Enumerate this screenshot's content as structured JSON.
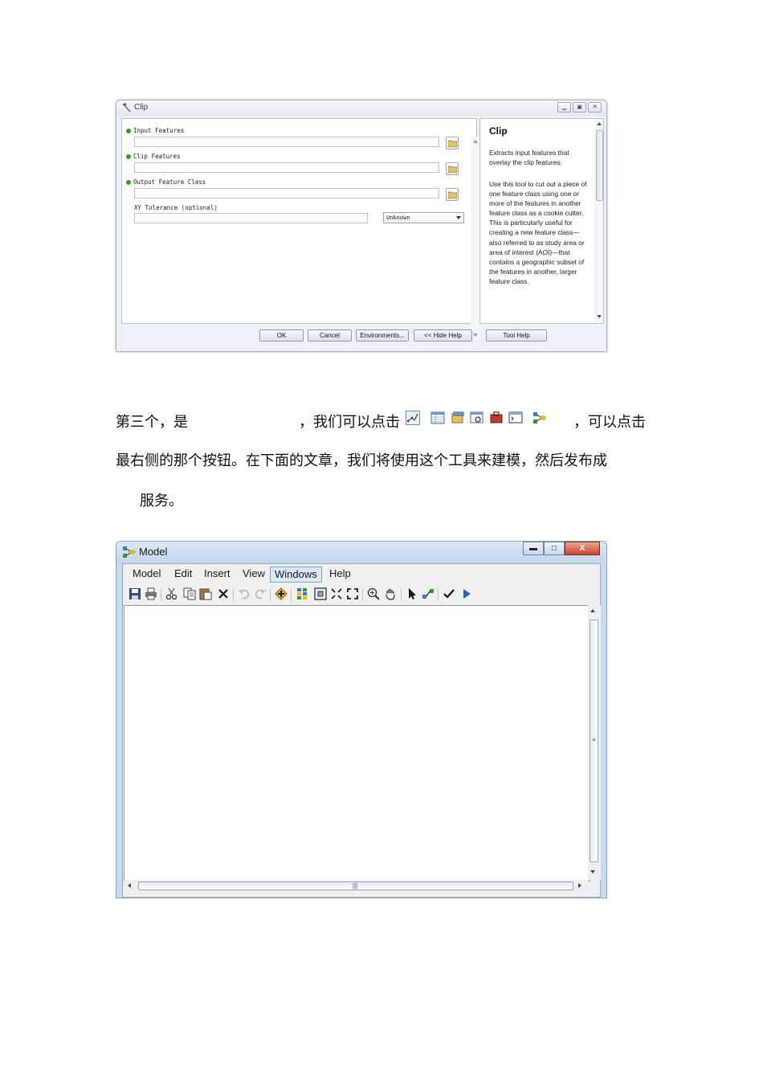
{
  "clip_dialog": {
    "title": "Clip",
    "window_controls": [
      "minimize",
      "restore",
      "close"
    ],
    "params": [
      {
        "label": "Input Features",
        "required": true,
        "value": ""
      },
      {
        "label": "Clip Features",
        "required": true,
        "value": ""
      },
      {
        "label": "Output Feature Class",
        "required": true,
        "value": ""
      },
      {
        "label": "XY Tolerance (optional)",
        "required": false,
        "value": ""
      }
    ],
    "unit_select": "Unknown",
    "help": {
      "title": "Clip",
      "p1": "Extracts input features that overlay the clip features.",
      "p2": "Use this tool to cut out a piece of one feature class using one or more of the features in another feature class as a cookie cutter. This is particularly useful for creating a new feature class—also referred to as study area or area of interest (AOI)—that contains a geographic subset of the features in another, larger feature class."
    },
    "buttons": {
      "ok": "OK",
      "cancel": "Cancel",
      "environments": "Environments...",
      "hide_help": "<< Hide Help",
      "tool_help": "Tool Help"
    }
  },
  "paragraph": {
    "line1_a": "第三个，是",
    "line1_b": "，我们可以点击",
    "line1_c": "，可以点击",
    "line2": "最右侧的那个按钮。在下面的文章，我们将使用这个工具来建模，然后发布成",
    "line3": "服务。",
    "inline_icons": [
      "editor-toolbar-icon",
      "table-icon",
      "catalog-icon",
      "search-window-icon",
      "arctoolbox-icon",
      "python-window-icon",
      "modelbuilder-icon"
    ]
  },
  "model_window": {
    "title": "Model",
    "window_controls": {
      "minimize": "▬",
      "maximize": "□",
      "close": "X"
    },
    "menu": [
      "Model",
      "Edit",
      "Insert",
      "View",
      "Windows",
      "Help"
    ],
    "active_menu": "Windows",
    "toolbar_icons": [
      "save-icon",
      "print-icon",
      "cut-icon",
      "copy-icon",
      "paste-icon",
      "delete-icon",
      "undo-icon",
      "redo-icon",
      "add-data-icon",
      "auto-layout-icon",
      "full-extent-icon",
      "fixed-zoom-in-icon",
      "fixed-zoom-out-icon",
      "zoom-in-icon",
      "pan-icon",
      "select-icon",
      "connect-icon",
      "validate-icon",
      "run-icon"
    ]
  }
}
